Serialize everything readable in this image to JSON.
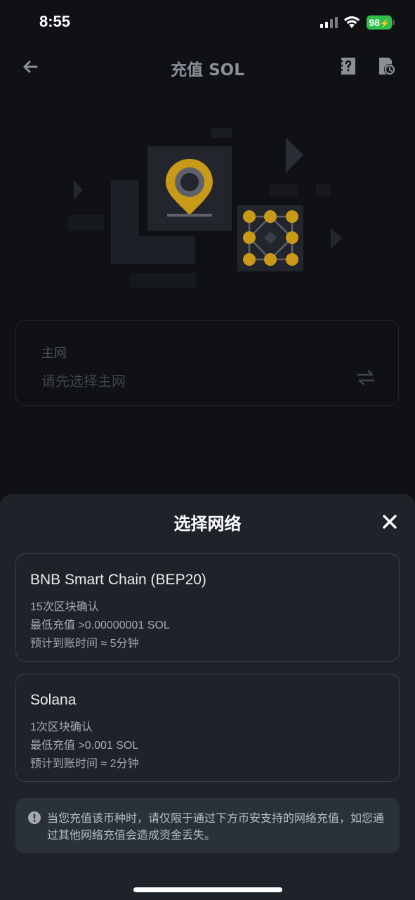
{
  "status_bar": {
    "time": "8:55",
    "battery": "98"
  },
  "header": {
    "title": "充值 SOL",
    "back_icon": "arrow-left-icon",
    "help_icon": "help-doc-icon",
    "history_icon": "history-doc-icon"
  },
  "network_selector": {
    "label": "主网",
    "placeholder": "请先选择主网",
    "icon": "swap-arrows-icon"
  },
  "sheet": {
    "title": "选择网络",
    "close_icon": "close-icon",
    "networks": [
      {
        "name": "BNB Smart Chain (BEP20)",
        "confirmations": "15次区块确认",
        "min_deposit": "最低充值 >0.00000001 SOL",
        "eta": "预计到账时间 ≈ 5分钟"
      },
      {
        "name": "Solana",
        "confirmations": "1次区块确认",
        "min_deposit": "最低充值 >0.001 SOL",
        "eta": "预计到账时间 ≈ 2分钟"
      }
    ],
    "notice": "当您充值该币种时，请仅限于通过下方币安支持的网络充值，如您通过其他网络充值会造成资金丢失。"
  },
  "colors": {
    "accent": "#c99a17",
    "sheet_bg": "#1e2329",
    "page_bg": "#0f1114",
    "battery": "#31c14b"
  }
}
